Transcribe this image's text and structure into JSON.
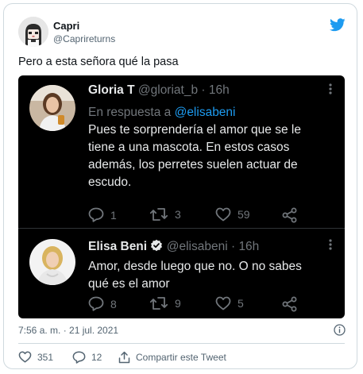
{
  "author": {
    "name": "Capri",
    "handle": "@Caprireturns"
  },
  "tweet": {
    "text": "Pero a esta señora qué la pasa"
  },
  "embedded": {
    "replies": [
      {
        "name": "Gloria T",
        "handle": "@gloriat_b",
        "time": "16h",
        "reply_prefix": "En respuesta a ",
        "reply_mention": "@elisabeni",
        "lines": [
          "Pues te sorprendería el amor que se le",
          "tiene a una mascota. En estos casos",
          "además, los perretes suelen actuar de",
          "escudo."
        ],
        "counts": {
          "replies": "1",
          "retweets": "3",
          "likes": "59"
        }
      },
      {
        "name": "Elisa Beni",
        "handle": "@elisabeni",
        "time": "16h",
        "lines": [
          "Amor, desde luego que no. O no sabes",
          "qué es el amor"
        ],
        "counts": {
          "replies": "8",
          "retweets": "9",
          "likes": "5"
        }
      }
    ],
    "separator": "·"
  },
  "meta": {
    "datetime": "7:56 a. m. · 21 jul. 2021"
  },
  "footer": {
    "likes": "351",
    "replies": "12",
    "share_label": "Compartir este Tweet"
  },
  "colors": {
    "brand": "#1d9bf0",
    "embed_bg": "#000000",
    "verified": "#e7e9ea"
  },
  "icons": [
    "twitter-bird-icon",
    "info-icon",
    "heart-icon",
    "reply-icon",
    "retweet-icon",
    "share-icon",
    "more-icon",
    "verified-badge-icon"
  ]
}
